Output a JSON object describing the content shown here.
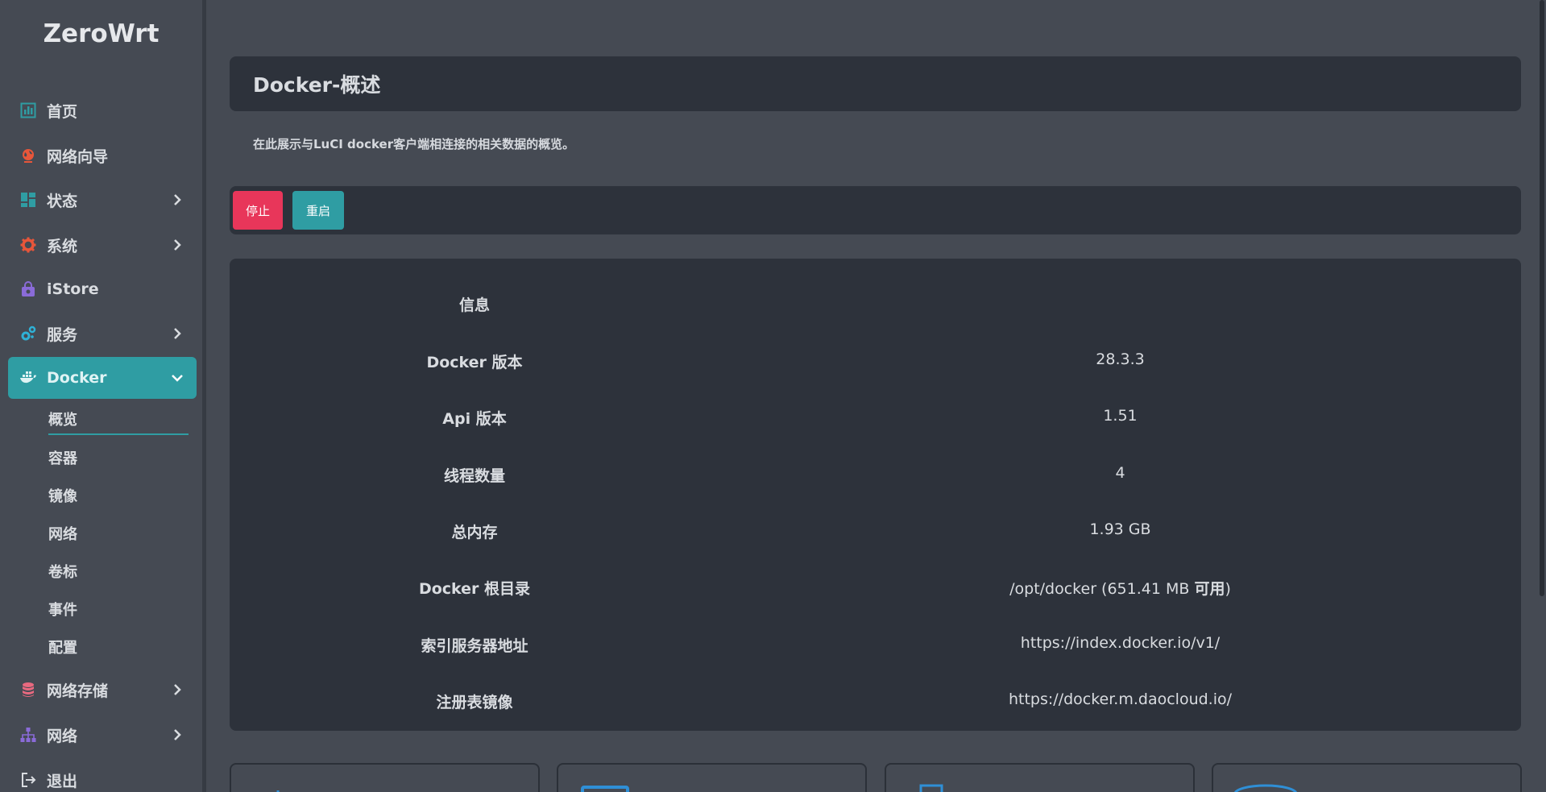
{
  "brand": "ZeroWrt",
  "nav": [
    {
      "label": "首页",
      "icon": "dashboard-icon",
      "color": "#2f9da3",
      "has_chevron": false
    },
    {
      "label": "网络向导",
      "icon": "globe-icon",
      "color": "#e8563a",
      "has_chevron": false
    },
    {
      "label": "状态",
      "icon": "grid-icon",
      "color": "#2f9da3",
      "has_chevron": true
    },
    {
      "label": "系统",
      "icon": "gear-icon",
      "color": "#e8563a",
      "has_chevron": true
    },
    {
      "label": "iStore",
      "icon": "store-bag-icon",
      "color": "#8a6bd8",
      "has_chevron": false
    },
    {
      "label": "服务",
      "icon": "cogs-icon",
      "color": "#2fb1d6",
      "has_chevron": true
    },
    {
      "label": "Docker",
      "icon": "docker-whale-icon",
      "color": "#dff3f4",
      "has_chevron": true,
      "active": true
    },
    {
      "label": "网络存储",
      "icon": "database-icon",
      "color": "#e8697f",
      "has_chevron": true
    },
    {
      "label": "网络",
      "icon": "network-tree-icon",
      "color": "#8a6bd8",
      "has_chevron": true
    },
    {
      "label": "退出",
      "icon": "logout-icon",
      "color": "#d9dce0",
      "has_chevron": false
    }
  ],
  "docker_submenu": [
    "概览",
    "容器",
    "镜像",
    "网络",
    "卷标",
    "事件",
    "配置"
  ],
  "page": {
    "title": "Docker-概述",
    "description": "在此展示与LuCI docker客户端相连接的相关数据的概览。"
  },
  "actions": {
    "stop_label": "停止",
    "restart_label": "重启"
  },
  "info": {
    "header": "信息",
    "rows": [
      {
        "key": "Docker 版本",
        "value": "28.3.3"
      },
      {
        "key": "Api 版本",
        "value": "1.51"
      },
      {
        "key": "线程数量",
        "value": "4"
      },
      {
        "key": "总内存",
        "value": "1.93 GB"
      },
      {
        "key": "Docker 根目录",
        "value": "/opt/docker (651.41 MB ",
        "value_strong": "可用",
        "value_tail": ")"
      },
      {
        "key": "索引服务器地址",
        "value": "https://index.docker.io/v1/"
      },
      {
        "key": "注册表镜像",
        "value": "https://docker.m.daocloud.io/"
      }
    ]
  },
  "colors": {
    "accent": "#2f9da3",
    "danger": "#e8365a",
    "panel": "#2d323b",
    "background": "#454a53"
  }
}
